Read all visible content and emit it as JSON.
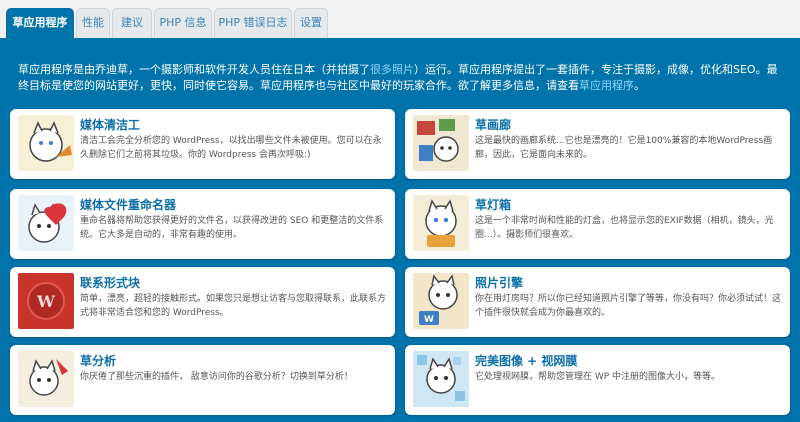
{
  "tabs": [
    {
      "label": "草应用程序",
      "active": true
    },
    {
      "label": "性能",
      "active": false
    },
    {
      "label": "建议",
      "active": false
    },
    {
      "label": "PHP 信息",
      "active": false
    },
    {
      "label": "PHP 错误日志",
      "active": false
    },
    {
      "label": "设置",
      "active": false
    }
  ],
  "intro": {
    "part1": "草应用程序是由乔迪草，一个摄影师和软件开发人员住在日本（并拍摄了",
    "link1": "很多照片",
    "part2": "）运行。草应用程序提出了一套插件，专注于摄影，成像，优化和SEO。最终目标是使您的网站更好，更快，同时使它容易。草应用程序也与社区中最好的玩家合作。欲了解更多信息，请查看",
    "link2": "草应用程序",
    "part3": "。"
  },
  "cards": [
    {
      "title": "媒体清洁工",
      "desc": "清洁工会完全分析您的 WordPress，以找出哪些文件未被使用。您可以在永久删除它们之前将其垃圾。你的 Wordpress 会再次呼吸:)",
      "icon": "media-cleaner-icon"
    },
    {
      "title": "草画廊",
      "desc": "这是最快的画廊系统...它也是漂亮的！它是100%兼容的本地WordPress画廊，因此，它是面向未来的。",
      "icon": "gallery-icon"
    },
    {
      "title": "媒体文件重命名器",
      "desc": "重命名器将帮助您获得更好的文件名，以获得改进的 SEO 和更整洁的文件系统。它大多是自动的，非常有趣的使用。",
      "icon": "file-renamer-icon"
    },
    {
      "title": "草灯箱",
      "desc": "这是一个非常时尚和性能的灯盒，也将显示您的EXIF数据（相机，镜头，光圈...）。摄影师们很喜欢。",
      "icon": "lightbox-icon"
    },
    {
      "title": "联系形式块",
      "desc": "简单，漂亮，超轻的接触形式。如果您只是想让访客与您取得联系，此联系方式将非常适合您和您的 WordPress。",
      "icon": "contact-form-icon"
    },
    {
      "title": "照片引擎",
      "desc": "你在用灯房吗？所以你已经知道照片引擎了等等，你没有吗？你必须试试！这个插件很快就会成为你最喜欢的。",
      "icon": "photo-engine-icon"
    },
    {
      "title": "草分析",
      "desc": "你厌倦了那些沉重的插件， 敌意访问你的谷歌分析？切换到草分析！",
      "icon": "analytics-icon"
    },
    {
      "title": "完美图像 + 视网膜",
      "desc": "它处理视网膜，帮助您管理在 WP 中注册的图像大小，等等。",
      "icon": "perfect-images-icon"
    }
  ],
  "colors": {
    "accent": "#0073aa",
    "link": "#8fd6ff",
    "card_title": "#0d6fa8"
  }
}
